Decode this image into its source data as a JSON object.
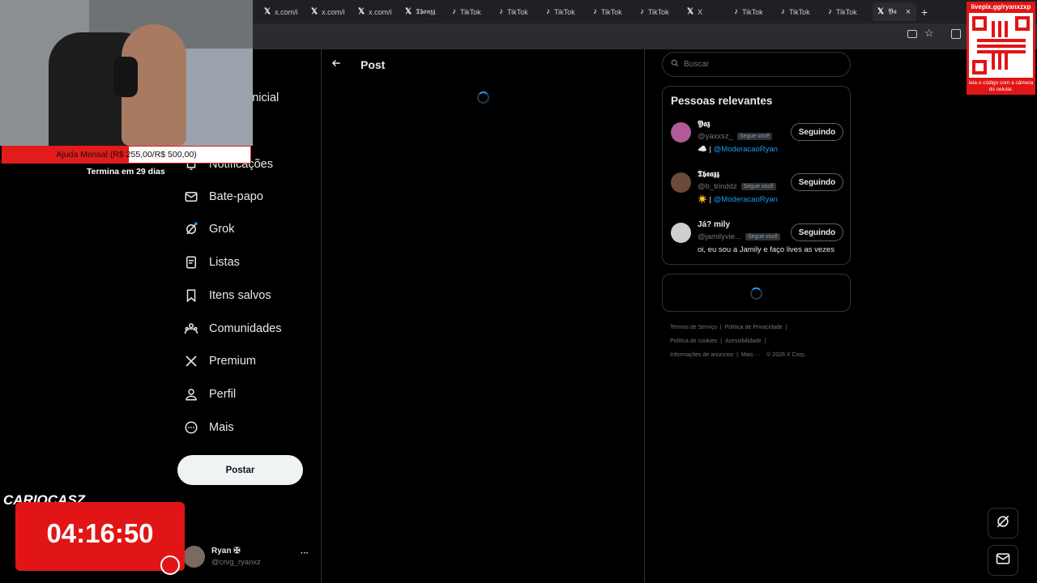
{
  "browser": {
    "tabs": [
      {
        "icon": "x-icon",
        "label": "x.com/i"
      },
      {
        "icon": "x-icon",
        "label": "x.com/i"
      },
      {
        "icon": "x-icon",
        "label": "x.com/i"
      },
      {
        "icon": "x-icon",
        "label": "𝕿𝖇𝖊𝖆𝖟𝖟"
      },
      {
        "icon": "tiktok-icon",
        "label": "TikTok"
      },
      {
        "icon": "tiktok-icon",
        "label": "TikTok"
      },
      {
        "icon": "tiktok-icon",
        "label": "TikTok"
      },
      {
        "icon": "tiktok-icon",
        "label": "TikTok"
      },
      {
        "icon": "tiktok-icon",
        "label": "TikTok"
      },
      {
        "icon": "x-icon",
        "label": "X"
      },
      {
        "icon": "tiktok-icon",
        "label": "TikTok"
      },
      {
        "icon": "tiktok-icon",
        "label": "TikTok"
      },
      {
        "icon": "tiktok-icon",
        "label": "TikTok"
      },
      {
        "icon": "x-icon",
        "label": "𝖄𝖆"
      }
    ],
    "new_tab": "+",
    "close_tab": "×"
  },
  "overlay": {
    "donation_label": "Ajuda Mensal (R$ 255,00/R$ 500,00)",
    "donation_progress": 0.51,
    "donation_ends": "Termina em 29 dias",
    "brand": "CARIOCASZ",
    "timer": "04:16:50",
    "qr_url": "livepix.gg/ryanxzxp",
    "qr_caption": "leia o código com a câmera do celular."
  },
  "nav": {
    "items": [
      {
        "icon": "home-icon",
        "label": "Página Inicial"
      },
      {
        "icon": "bell-icon",
        "label": "Notificações"
      },
      {
        "icon": "mail-icon",
        "label": "Bate-papo"
      },
      {
        "icon": "grok-icon",
        "label": "Grok"
      },
      {
        "icon": "list-icon",
        "label": "Listas"
      },
      {
        "icon": "bookmark-icon",
        "label": "Itens salvos"
      },
      {
        "icon": "communities-icon",
        "label": "Comunidades"
      },
      {
        "icon": "x-icon",
        "label": "Premium"
      },
      {
        "icon": "person-icon",
        "label": "Perfil"
      },
      {
        "icon": "more-circle-icon",
        "label": "Mais"
      }
    ],
    "post_button": "Postar",
    "account": {
      "name": "Ryan ✠",
      "handle": "@crvg_ryanxz",
      "menu": "···"
    }
  },
  "main": {
    "title": "Post",
    "back_icon": "arrow-left-icon"
  },
  "right": {
    "search_placeholder": "Buscar",
    "people_title": "Pessoas relevantes",
    "people": [
      {
        "name": "𝖄𝖆𝖟",
        "handle": "@yaxxsz_",
        "badge": "Segue você",
        "bio_prefix": "☁️ | ",
        "bio_link": "@ModeracaoRyan",
        "bio": "",
        "button": "Seguindo",
        "avatar_color": "#b05a9a"
      },
      {
        "name": "𝕿𝖇𝖊𝖆𝖟𝖟",
        "handle": "@b_trinddz",
        "badge": "Segue você",
        "bio_prefix": "☀️ | ",
        "bio_link": "@ModeracaoRyan",
        "bio": "",
        "button": "Seguindo",
        "avatar_color": "#6b4a3a"
      },
      {
        "name": "Já? mily",
        "handle": "@jamilyvie...",
        "badge": "Segue você",
        "bio_prefix": "",
        "bio_link": "",
        "bio": "oi, eu sou a Jamily e faço lives as vezes",
        "button": "Seguindo",
        "avatar_color": "#cfcfcf"
      }
    ],
    "footer": {
      "row1": [
        "Termos de Serviço",
        "Política de Privacidade"
      ],
      "row2": [
        "Política de cookies",
        "Acessibilidade"
      ],
      "row3": [
        "Informações de anúncios",
        "Mais ···",
        "© 2026 X Corp."
      ]
    }
  },
  "colors": {
    "accent": "#1d9bf0",
    "overlay_red": "#e11515"
  }
}
